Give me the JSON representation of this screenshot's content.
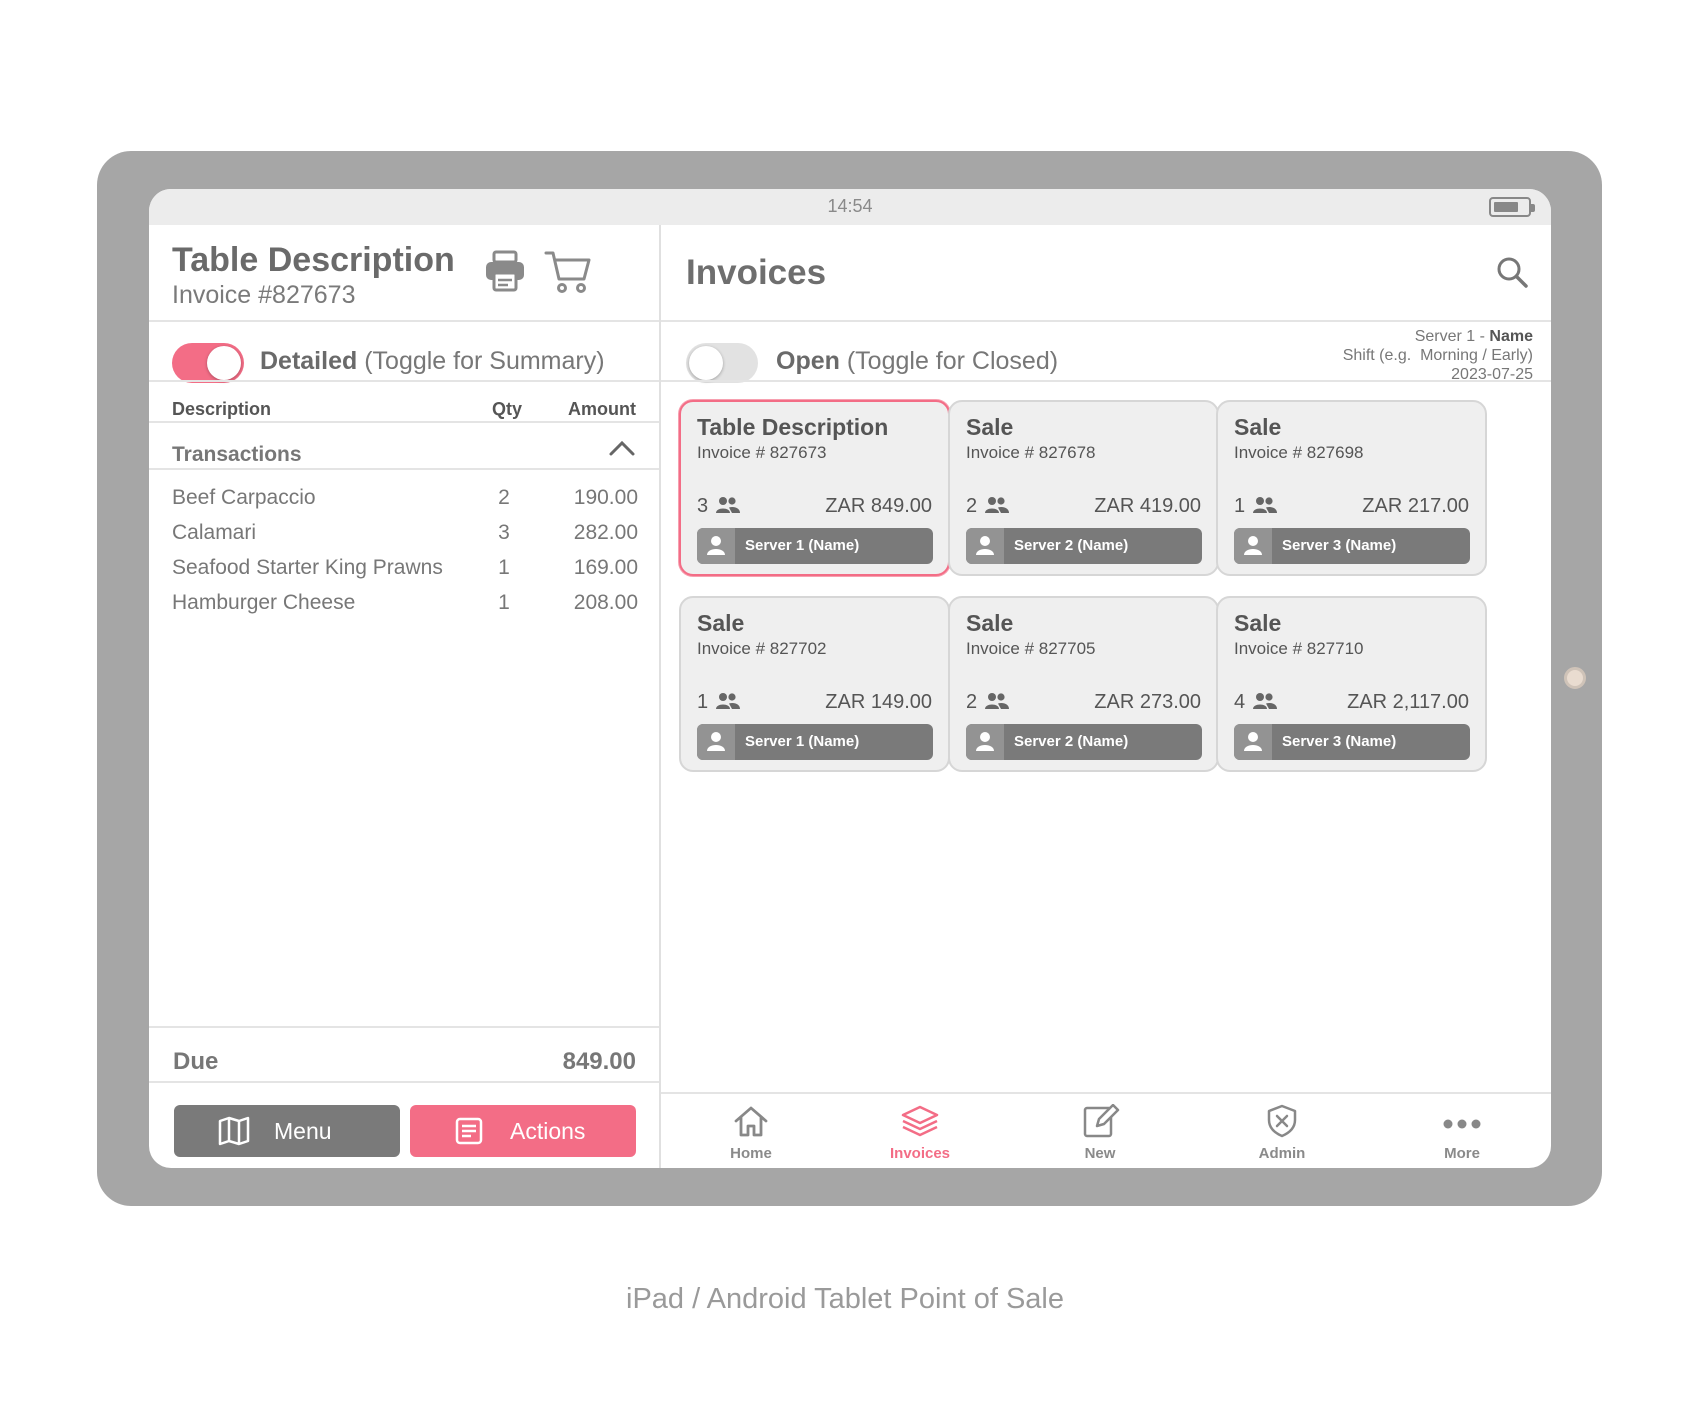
{
  "status_bar": {
    "time": "14:54"
  },
  "order_panel": {
    "title": "Table Description",
    "invoice": "Invoice #827673",
    "toggle_bold": "Detailed",
    "toggle_hint": "(Toggle for Summary)",
    "columns": {
      "description": "Description",
      "qty": "Qty",
      "amount": "Amount"
    },
    "section": "Transactions",
    "items": [
      {
        "description": "Beef Carpaccio",
        "qty": "2",
        "amount": "190.00"
      },
      {
        "description": "Calamari",
        "qty": "3",
        "amount": "282.00"
      },
      {
        "description": "Seafood Starter King Prawns",
        "qty": "1",
        "amount": "169.00"
      },
      {
        "description": "Hamburger Cheese",
        "qty": "1",
        "amount": "208.00"
      }
    ],
    "due_label": "Due",
    "due_value": "849.00",
    "menu_button": "Menu",
    "actions_button": "Actions"
  },
  "invoices_panel": {
    "title": "Invoices",
    "toggle_bold": "Open",
    "toggle_hint": "(Toggle for Closed)",
    "server_line_prefix": "Server 1 - ",
    "server_line_name": "Name",
    "shift_line": "Shift (e.g.  Morning / Early)",
    "date": "2023-07-25",
    "cards": [
      {
        "title": "Table Description",
        "invoice": "Invoice # 827673",
        "guests": "3",
        "amount": "ZAR 849.00",
        "server": "Server 1 (Name)"
      },
      {
        "title": "Sale",
        "invoice": "Invoice # 827678",
        "guests": "2",
        "amount": "ZAR 419.00",
        "server": "Server 2 (Name)"
      },
      {
        "title": "Sale",
        "invoice": "Invoice # 827698",
        "guests": "1",
        "amount": "ZAR 217.00",
        "server": "Server 3 (Name)"
      },
      {
        "title": "Sale",
        "invoice": "Invoice # 827702",
        "guests": "1",
        "amount": "ZAR 149.00",
        "server": "Server 1 (Name)"
      },
      {
        "title": "Sale",
        "invoice": "Invoice # 827705",
        "guests": "2",
        "amount": "ZAR 273.00",
        "server": "Server 2 (Name)"
      },
      {
        "title": "Sale",
        "invoice": "Invoice # 827710",
        "guests": "4",
        "amount": "ZAR 2,117.00",
        "server": "Server 3 (Name)"
      }
    ]
  },
  "bottom_nav": {
    "items": [
      {
        "label": "Home",
        "icon": "home-icon"
      },
      {
        "label": "Invoices",
        "icon": "layers-icon"
      },
      {
        "label": "New",
        "icon": "edit-icon"
      },
      {
        "label": "Admin",
        "icon": "shield-icon"
      },
      {
        "label": "More",
        "icon": "more-icon"
      }
    ],
    "active": "Invoices"
  },
  "caption": "iPad / Android Tablet Point of Sale",
  "colors": {
    "accent": "#f36d86",
    "frame": "#a6a6a6",
    "card": "#efefef",
    "server_bar": "#7a7a7a"
  }
}
